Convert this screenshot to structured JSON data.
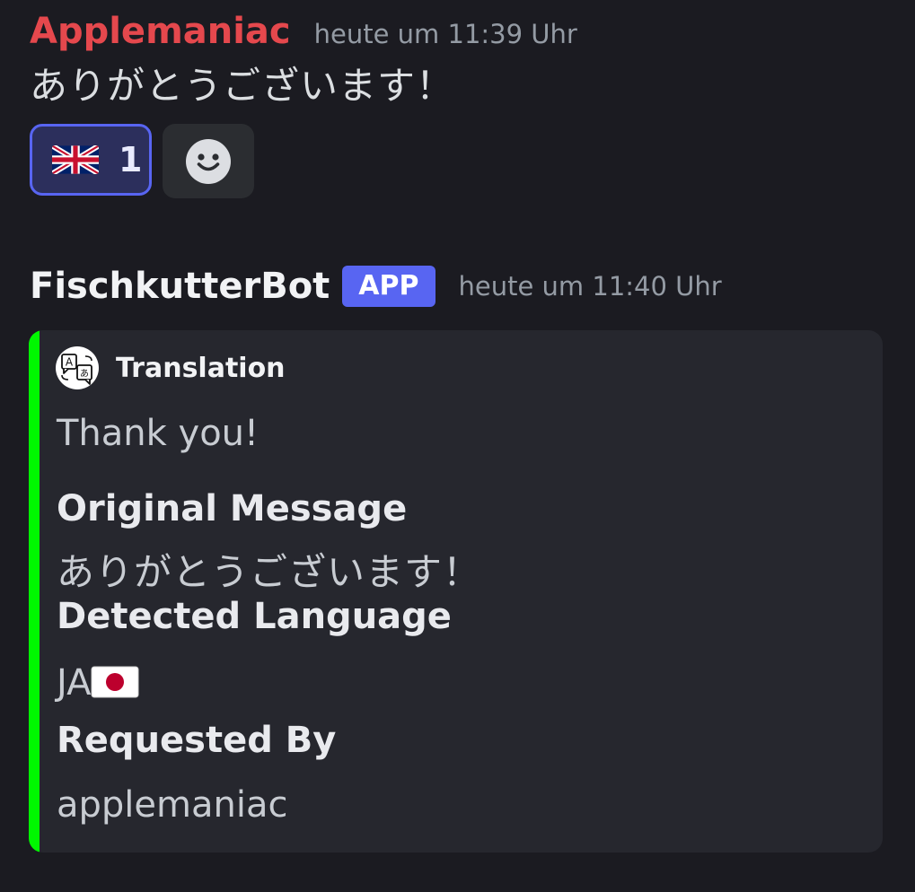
{
  "message1": {
    "author": "Applemaniac",
    "timestamp": "heute um 11:39 Uhr",
    "content": "ありがとうございます！",
    "reactions": [
      {
        "emoji": "uk-flag-icon",
        "count": "1",
        "selected": true
      }
    ],
    "add_reaction_icon": "smiley-icon"
  },
  "message2": {
    "author": "FischkutterBot",
    "badge": "APP",
    "timestamp": "heute um 11:40 Uhr",
    "embed": {
      "accent_color": "#00f700",
      "author_icon": "translate-icon",
      "author_name": "Translation",
      "description": "Thank you!",
      "fields": [
        {
          "name": "Original Message",
          "value": "ありがとうございます！"
        },
        {
          "name": "Detected Language",
          "value": "JA",
          "value_icon": "japan-flag-icon"
        },
        {
          "name": "Requested By",
          "value": "applemaniac"
        }
      ]
    }
  },
  "colors": {
    "background": "#1b1b21",
    "author1": "#e5484d",
    "badge": "#5865f2",
    "reaction_border": "#5865f2"
  }
}
